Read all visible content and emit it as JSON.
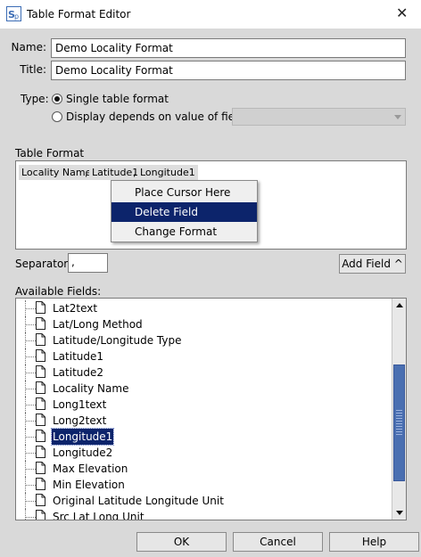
{
  "window": {
    "title": "Table Format Editor",
    "close_glyph": "✕",
    "icon": "specify-logo-icon"
  },
  "form": {
    "name_label": "Name:",
    "name_value": "Demo Locality Format",
    "title_label": "Title:",
    "title_value": "Demo Locality Format",
    "type_label": "Type:",
    "type_options": [
      {
        "label": "Single table format",
        "selected": true
      },
      {
        "label": "Display depends on value of field:",
        "selected": false
      }
    ],
    "field_select_value": ""
  },
  "table_format": {
    "label": "Table Format",
    "fields": [
      "Locality Name",
      "Latitude1",
      "Longitude1"
    ],
    "separators": [
      ",",
      ","
    ]
  },
  "context_menu": {
    "items": [
      {
        "label": "Place Cursor Here",
        "selected": false
      },
      {
        "label": "Delete Field",
        "selected": true
      },
      {
        "label": "Change Format",
        "selected": false
      }
    ]
  },
  "separator": {
    "label": "Separator:",
    "value": ","
  },
  "add_field_button": "Add Field ^",
  "available_fields": {
    "label": "Available Fields:",
    "items": [
      {
        "label": "Lat2text",
        "selected": false
      },
      {
        "label": "Lat/Long Method",
        "selected": false
      },
      {
        "label": "Latitude/Longitude Type",
        "selected": false
      },
      {
        "label": "Latitude1",
        "selected": false
      },
      {
        "label": "Latitude2",
        "selected": false
      },
      {
        "label": "Locality Name",
        "selected": false
      },
      {
        "label": "Long1text",
        "selected": false
      },
      {
        "label": "Long2text",
        "selected": false
      },
      {
        "label": "Longitude1",
        "selected": true
      },
      {
        "label": "Longitude2",
        "selected": false
      },
      {
        "label": "Max Elevation",
        "selected": false
      },
      {
        "label": "Min Elevation",
        "selected": false
      },
      {
        "label": "Original Latitude Longitude Unit",
        "selected": false
      },
      {
        "label": "Src Lat Long Unit",
        "selected": false
      }
    ]
  },
  "buttons": {
    "ok": "OK",
    "cancel": "Cancel",
    "help": "Help"
  },
  "colors": {
    "selection": "#0c246b",
    "scroll_thumb": "#4a6fb1",
    "dialog_bg": "#d9d9d9"
  }
}
